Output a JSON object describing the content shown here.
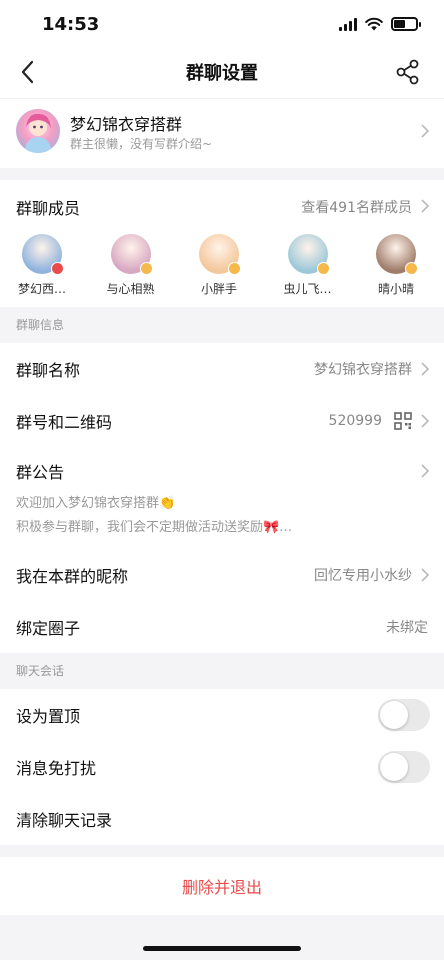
{
  "status": {
    "time": "14:53"
  },
  "nav": {
    "title": "群聊设置"
  },
  "group": {
    "name": "梦幻锦衣穿搭群",
    "desc": "群主很懒，没有写群介绍~"
  },
  "members": {
    "label": "群聊成员",
    "view_all": "查看491名群成员",
    "list": [
      {
        "name": "梦幻西…",
        "avatar_color": "#8fb3dd",
        "badge_color": "#e94a4a"
      },
      {
        "name": "与心相熟",
        "avatar_color": "#d8a7c2",
        "badge_color": "#f5b84a"
      },
      {
        "name": "小胖手",
        "avatar_color": "#f3c79a",
        "badge_color": "#f5b84a"
      },
      {
        "name": "虫儿飞…",
        "avatar_color": "#9cc8d9",
        "badge_color": "#f5b84a"
      },
      {
        "name": "晴小晴",
        "avatar_color": "#a07c6a",
        "badge_color": "#f5b84a"
      }
    ]
  },
  "info_section": {
    "title": "群聊信息",
    "name_label": "群聊名称",
    "name_value": "梦幻锦衣穿搭群",
    "id_label": "群号和二维码",
    "id_value": "520999",
    "notice_label": "群公告",
    "notice_line1": "欢迎加入梦幻锦衣穿搭群👏",
    "notice_line2": "积极参与群聊，我们会不定期做活动送奖励🎀…",
    "nickname_label": "我在本群的昵称",
    "nickname_value": "回忆专用小水纱",
    "circle_label": "绑定圈子",
    "circle_value": "未绑定"
  },
  "chat_section": {
    "title": "聊天会话",
    "pin_label": "设为置顶",
    "pin_on": false,
    "mute_label": "消息免打扰",
    "mute_on": false,
    "clear_label": "清除聊天记录"
  },
  "exit": {
    "label": "删除并退出",
    "color": "#e94a4a"
  }
}
